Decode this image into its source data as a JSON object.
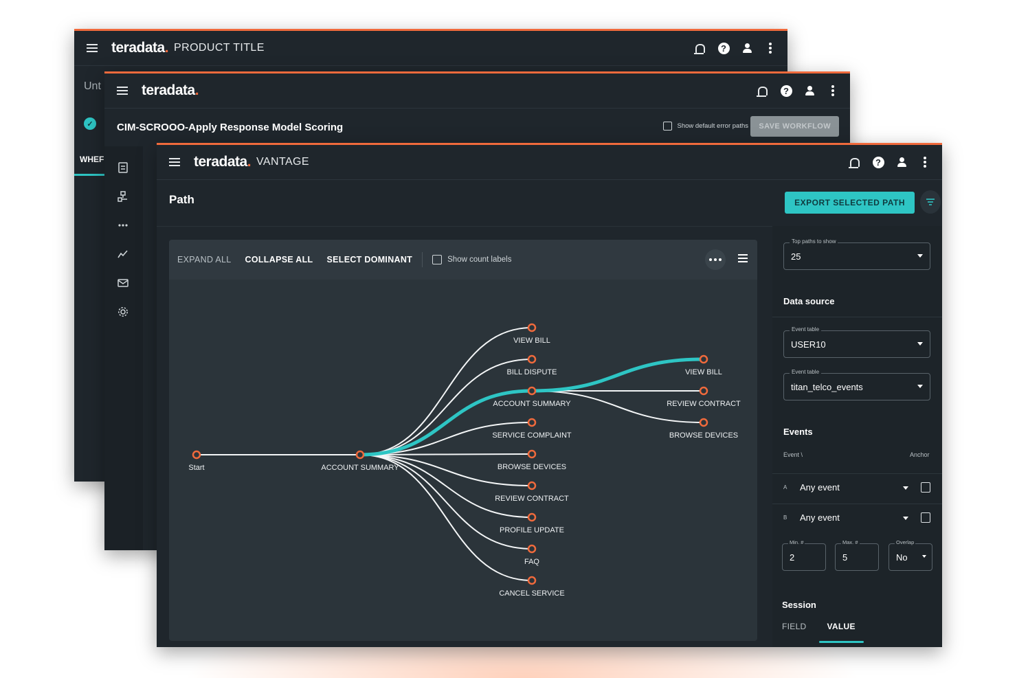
{
  "colors": {
    "accent_teal": "#2ec5c4",
    "accent_orange": "#f06a3c",
    "window_bg": "#1f262c"
  },
  "window_back": {
    "brand": "teradata",
    "brand_dot": ".",
    "product": "PRODUCT TITLE",
    "partial_text": "Unt",
    "partial_tab": "WHEF",
    "icons": [
      "bell-icon",
      "help-icon",
      "user-icon",
      "kebab-icon"
    ]
  },
  "window_middle": {
    "brand": "teradata",
    "brand_dot": ".",
    "workflow_title": "CIM-SCROOO-Apply Response Model Scoring",
    "show_error_paths_label": "Show default error paths",
    "save_label": "SAVE WORKFLOW",
    "sidebar_icons": [
      "document-icon",
      "flow-icon",
      "more-icon",
      "trend-icon",
      "mail-icon",
      "gear-icon"
    ]
  },
  "window_front": {
    "brand": "teradata",
    "brand_dot": ".",
    "product": "VANTAGE",
    "page_title": "Path",
    "export_label": "EXPORT SELECTED PATH",
    "toolbar": {
      "expand_all": "EXPAND ALL",
      "collapse_all": "COLLAPSE ALL",
      "select_dominant": "SELECT DOMINANT",
      "show_count_labels": "Show count labels"
    },
    "tree": {
      "root": "Start",
      "level1": "ACCOUNT SUMMARY",
      "level2": [
        "VIEW BILL",
        "BILL DISPUTE",
        "ACCOUNT SUMMARY",
        "SERVICE COMPLAINT",
        "BROWSE DEVICES",
        "REVIEW CONTRACT",
        "PROFILE UPDATE",
        "FAQ",
        "CANCEL SERVICE"
      ],
      "level3": [
        "VIEW BILL",
        "REVIEW CONTRACT",
        "BROWSE DEVICES"
      ],
      "selected_path": [
        "Start",
        "ACCOUNT SUMMARY",
        "ACCOUNT SUMMARY",
        "VIEW BILL"
      ]
    },
    "panel": {
      "top_paths_label": "Top paths to show",
      "top_paths_value": "25",
      "data_source_title": "Data source",
      "event_table_label": "Event table",
      "event_table_value": "USER10",
      "event_table2_label": "Event table",
      "event_table2_value": "titan_telco_events",
      "events_title": "Events",
      "event_col": "Event \\",
      "anchor_col": "Anchor",
      "events": [
        {
          "letter": "A",
          "value": "Any event"
        },
        {
          "letter": "B",
          "value": "Any event"
        }
      ],
      "min_label": "Min. #",
      "min_value": "2",
      "max_label": "Max. #",
      "max_value": "5",
      "overlap_label": "Overlap",
      "overlap_value": "No",
      "session_title": "Session",
      "tab_field": "FIELD",
      "tab_value": "VALUE"
    }
  }
}
